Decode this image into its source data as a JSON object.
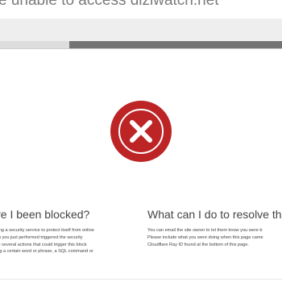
{
  "page": {
    "heading": "e unable to access diziwatch.net"
  },
  "left_section": {
    "title": "ave I been blocked?",
    "body": "is using a security service to protect itself from online\naction you just performed triggered the security\nre are several actions that could trigger this block\nmitting a certain word or phrase, a SQL command or\nata."
  },
  "right_section": {
    "title": "What can I do to resolve this?",
    "body": "You can email the site owner to let them know you were b\nPlease include what you were doing when this page came\nCloudflare Ray ID found at the bottom of this page."
  },
  "icon": {
    "name": "error-x-icon",
    "color": "#bd2426"
  }
}
